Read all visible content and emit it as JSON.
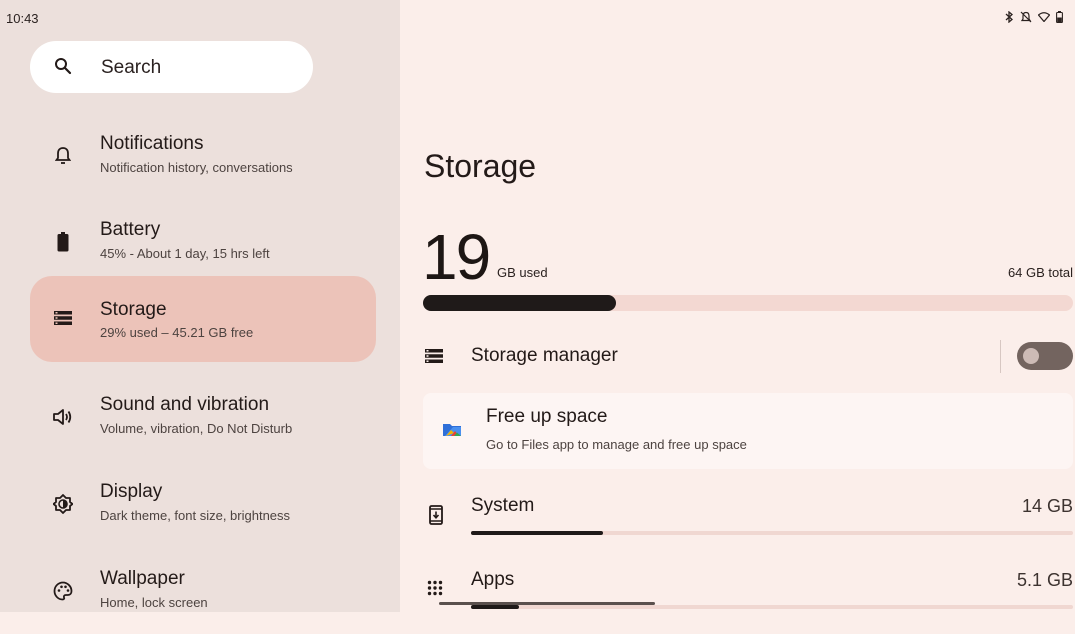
{
  "status_bar": {
    "time": "10:43"
  },
  "sidebar": {
    "search": {
      "label": "Search"
    },
    "items": [
      {
        "id": "notifications",
        "title": "Notifications",
        "subtitle": "Notification history, conversations",
        "icon": "bell-icon"
      },
      {
        "id": "battery",
        "title": "Battery",
        "subtitle": "45% - About 1 day, 15 hrs left",
        "icon": "battery-icon"
      },
      {
        "id": "storage",
        "title": "Storage",
        "subtitle": "29% used – 45.21 GB free",
        "icon": "storage-icon",
        "selected": true
      },
      {
        "id": "sound",
        "title": "Sound and vibration",
        "subtitle": "Volume, vibration, Do Not Disturb",
        "icon": "speaker-icon"
      },
      {
        "id": "display",
        "title": "Display",
        "subtitle": "Dark theme, font size, brightness",
        "icon": "brightness-icon"
      },
      {
        "id": "wallpaper",
        "title": "Wallpaper",
        "subtitle": "Home, lock screen",
        "icon": "palette-icon"
      }
    ]
  },
  "main": {
    "title": "Storage",
    "usage": {
      "used_value": "19",
      "used_label": "GB used",
      "total_label": "64 GB total",
      "used_fraction": 0.297
    },
    "storage_manager": {
      "label": "Storage manager",
      "enabled": false
    },
    "free_up": {
      "title": "Free up space",
      "subtitle": "Go to Files app to manage and free up space"
    },
    "categories": [
      {
        "name": "System",
        "size": "14 GB",
        "fraction": 0.22,
        "icon": "system-update-icon"
      },
      {
        "name": "Apps",
        "size": "5.1 GB",
        "fraction": 0.08,
        "icon": "apps-grid-icon"
      }
    ]
  },
  "colors": {
    "accent_selected": "#ecc3b9",
    "bar_fill": "#1f1a19",
    "sidebar_bg": "#ece0dc",
    "main_bg": "#fbeeea"
  }
}
